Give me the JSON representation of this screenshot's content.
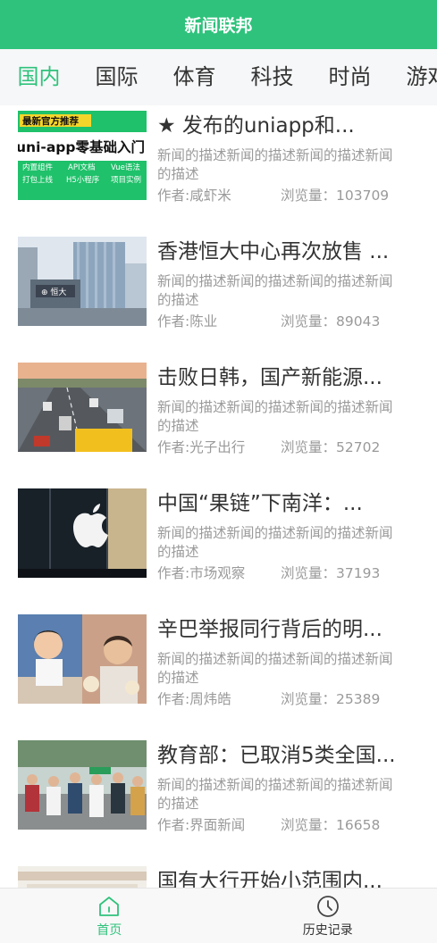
{
  "header": {
    "title": "新闻联邦"
  },
  "tabs": [
    "国内",
    "国际",
    "体育",
    "科技",
    "时尚",
    "游戏"
  ],
  "news": [
    {
      "title": "★ 发布的uniapp和...",
      "desc": "新闻的描述新闻的描述新闻的描述新闻的描述",
      "author": "作者:咸虾米",
      "views": "浏览量：103709",
      "banner": {
        "tag": "最新官方推荐",
        "headline": "uni-app零基础入门",
        "keywords": [
          "内置组件",
          "API文档",
          "Vue语法",
          "打包上线",
          "H5小程序",
          "项目实例"
        ]
      }
    },
    {
      "title": "香港恒大中心再次放售 ...",
      "desc": "新闻的描述新闻的描述新闻的描述新闻的描述",
      "author": "作者:陈业",
      "views": "浏览量：89043"
    },
    {
      "title": "击败日韩，国产新能源...",
      "desc": "新闻的描述新闻的描述新闻的描述新闻的描述",
      "author": "作者:光子出行",
      "views": "浏览量：52702"
    },
    {
      "title": "中国“果链”下南洋：...",
      "desc": "新闻的描述新闻的描述新闻的描述新闻的描述",
      "author": "作者:市场观察",
      "views": "浏览量：37193"
    },
    {
      "title": "辛巴举报同行背后的明...",
      "desc": "新闻的描述新闻的描述新闻的描述新闻的描述",
      "author": "作者:周炜皓",
      "views": "浏览量：25389"
    },
    {
      "title": "教育部：已取消5类全国...",
      "desc": "新闻的描述新闻的描述新闻的描述新闻的描述",
      "author": "作者:界面新闻",
      "views": "浏览量：16658"
    },
    {
      "title": "国有大行开始小范围内..."
    }
  ],
  "tabbar": [
    {
      "label": "首页",
      "icon": "home-icon",
      "active": true
    },
    {
      "label": "历史记录",
      "icon": "clock-icon",
      "active": false
    }
  ],
  "colors": {
    "accent": "#2fc27c",
    "text": "#333333",
    "muted": "#9a9a9a"
  }
}
